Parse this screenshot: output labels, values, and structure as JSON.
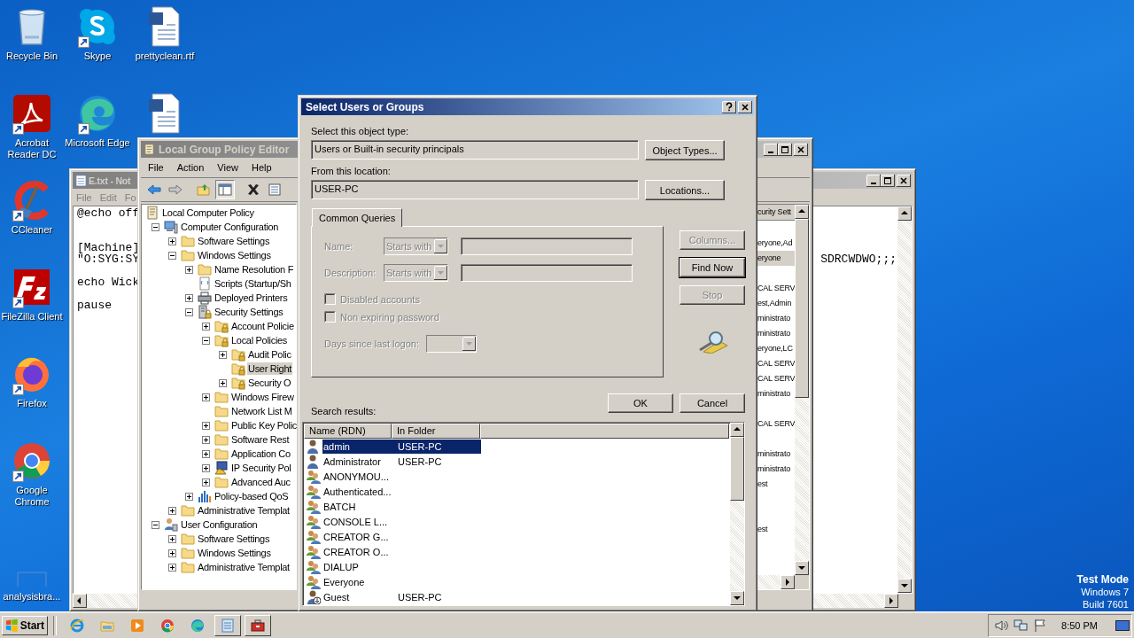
{
  "desktop": {
    "columns": [
      {
        "icons": [
          {
            "label": "Recycle Bin",
            "kind": "recycle",
            "shortcut": false
          },
          {
            "label": "Acrobat Reader DC",
            "kind": "acrobat",
            "shortcut": true
          },
          {
            "label": "CCleaner",
            "kind": "ccleaner",
            "shortcut": true
          },
          {
            "label": "FileZilla Client",
            "kind": "filezilla",
            "shortcut": true
          },
          {
            "label": "Firefox",
            "kind": "firefox",
            "shortcut": true
          },
          {
            "label": "Google Chrome",
            "kind": "chrome",
            "shortcut": true
          },
          {
            "label": "analysisbra...",
            "kind": "blank",
            "shortcut": false
          }
        ]
      },
      {
        "icons": [
          {
            "label": "Skype",
            "kind": "skype",
            "shortcut": true
          },
          {
            "label": "Microsoft Edge",
            "kind": "edge",
            "shortcut": true
          }
        ]
      },
      {
        "icons": [
          {
            "label": "prettyclean.rtf",
            "kind": "word",
            "shortcut": false
          },
          {
            "kind": "word",
            "shortcut": false
          }
        ]
      }
    ]
  },
  "system_text": [
    "Test Mode",
    "Windows 7",
    "Build 7601"
  ],
  "notepad": {
    "title": "E.txt - Not",
    "menu": [
      "File",
      "Edit",
      "Fo"
    ],
    "lines": [
      {
        "kind": "text",
        "left": "@echo off"
      },
      {
        "kind": "blank"
      },
      {
        "kind": "blank"
      },
      {
        "kind": "text",
        "left": "[Machine]"
      },
      {
        "kind": "text",
        "left": "\"O:SYG:SY",
        "right": "SDRCWDWO;;;"
      },
      {
        "kind": "blank"
      },
      {
        "kind": "text",
        "left": "echo Wick"
      },
      {
        "kind": "blank"
      },
      {
        "kind": "text",
        "left": "pause"
      }
    ]
  },
  "policy_editor": {
    "title": "Local Group Policy Editor",
    "menu": [
      "File",
      "Action",
      "View",
      "Help"
    ],
    "toolbar": [
      {
        "kind": "back",
        "pressed": false
      },
      {
        "kind": "forward",
        "pressed": false
      },
      {
        "kind": "up",
        "pressed": false
      },
      {
        "kind": "console",
        "pressed": true
      },
      {
        "kind": "delete",
        "pressed": false
      },
      {
        "kind": "properties",
        "pressed": false
      }
    ],
    "tree": [
      {
        "label": "Local Computer Policy",
        "kind": "scroll",
        "selected": false,
        "children": [
          {
            "label": "Computer Configuration",
            "kind": "computer",
            "expanded": true,
            "selected": false,
            "children": [
              {
                "label": "Software Settings",
                "kind": "folder",
                "expanded": false,
                "selected": false
              },
              {
                "label": "Windows Settings",
                "kind": "folder",
                "expanded": true,
                "selected": false,
                "children": [
                  {
                    "label": "Name Resolution F",
                    "kind": "folder",
                    "expanded": false,
                    "selected": false
                  },
                  {
                    "label": "Scripts (Startup/Sh",
                    "kind": "script",
                    "selected": false
                  },
                  {
                    "label": "Deployed Printers",
                    "kind": "printer",
                    "expanded": false,
                    "selected": false
                  },
                  {
                    "label": "Security Settings",
                    "kind": "server",
                    "expanded": true,
                    "selected": false,
                    "children": [
                      {
                        "label": "Account Policie",
                        "kind": "lock-folder",
                        "expanded": false,
                        "selected": false
                      },
                      {
                        "label": "Local Policies",
                        "kind": "lock-folder",
                        "expanded": true,
                        "selected": false,
                        "children": [
                          {
                            "label": "Audit Polic",
                            "kind": "lock-folder",
                            "expanded": false,
                            "selected": false
                          },
                          {
                            "label": "User Right",
                            "kind": "lock-folder",
                            "selected": true
                          },
                          {
                            "label": "Security O",
                            "kind": "lock-folder",
                            "expanded": false,
                            "selected": false
                          }
                        ]
                      },
                      {
                        "label": "Windows Firew",
                        "kind": "folder",
                        "expanded": false,
                        "selected": false
                      },
                      {
                        "label": "Network List M",
                        "kind": "folder",
                        "selected": false
                      },
                      {
                        "label": "Public Key Polic",
                        "kind": "folder",
                        "expanded": false,
                        "selected": false
                      },
                      {
                        "label": "Software Rest",
                        "kind": "folder",
                        "expanded": false,
                        "selected": false
                      },
                      {
                        "label": "Application Co",
                        "kind": "folder",
                        "expanded": false,
                        "selected": false
                      },
                      {
                        "label": "IP Security Pol",
                        "kind": "monitor",
                        "expanded": false,
                        "selected": false
                      },
                      {
                        "label": "Advanced Auc",
                        "kind": "folder",
                        "expanded": false,
                        "selected": false
                      }
                    ]
                  },
                  {
                    "label": "Policy-based QoS",
                    "kind": "chart",
                    "expanded": false,
                    "selected": false
                  }
                ]
              },
              {
                "label": "Administrative Templat",
                "kind": "folder",
                "expanded": false,
                "selected": false
              }
            ]
          },
          {
            "label": "User Configuration",
            "kind": "users",
            "expanded": true,
            "selected": false,
            "children": [
              {
                "label": "Software Settings",
                "kind": "folder",
                "expanded": false,
                "selected": false
              },
              {
                "label": "Windows Settings",
                "kind": "folder",
                "expanded": false,
                "selected": false
              },
              {
                "label": "Administrative Templat",
                "kind": "folder",
                "expanded": false,
                "selected": false
              }
            ]
          }
        ]
      }
    ],
    "list_header": "curity Sett",
    "list_rows": [
      {
        "kind": "blank"
      },
      {
        "kind": "text",
        "text": "eryone,Ad",
        "selected": false
      },
      {
        "kind": "text",
        "text": "eryone",
        "selected": true
      },
      {
        "kind": "blank"
      },
      {
        "kind": "text",
        "text": "CAL SERV",
        "selected": false
      },
      {
        "kind": "text",
        "text": "est,Admin",
        "selected": false
      },
      {
        "kind": "text",
        "text": "ministrato",
        "selected": false
      },
      {
        "kind": "text",
        "text": "ministrato",
        "selected": false
      },
      {
        "kind": "text",
        "text": "eryone,LC",
        "selected": false
      },
      {
        "kind": "text",
        "text": "CAL SERV",
        "selected": false
      },
      {
        "kind": "text",
        "text": "CAL SERV",
        "selected": false
      },
      {
        "kind": "text",
        "text": "ministrato",
        "selected": false
      },
      {
        "kind": "blank"
      },
      {
        "kind": "text",
        "text": "CAL SERV",
        "selected": false
      },
      {
        "kind": "blank"
      },
      {
        "kind": "text",
        "text": "ministrato",
        "selected": false
      },
      {
        "kind": "text",
        "text": "ministrato",
        "selected": false
      },
      {
        "kind": "text",
        "text": "est",
        "selected": false
      },
      {
        "kind": "blank"
      },
      {
        "kind": "blank"
      },
      {
        "kind": "text",
        "text": "est",
        "selected": false
      }
    ]
  },
  "dialog": {
    "title": "Select Users or Groups",
    "object_type": {
      "label": "Select this object type:",
      "value": "Users or Built-in security principals",
      "button": "Object Types..."
    },
    "location": {
      "label": "From this location:",
      "value": "USER-PC",
      "button": "Locations..."
    },
    "tabs": [
      {
        "label": "Common Queries",
        "selected": true
      }
    ],
    "query": {
      "disabled": true,
      "name_label": "Name:",
      "name_mode": "Starts with",
      "description_label": "Description:",
      "description_mode": "Starts with",
      "checkboxes": [
        {
          "label": "Disabled accounts",
          "checked": false
        },
        {
          "label": "Non expiring password",
          "checked": false
        }
      ],
      "days_label": "Days since last logon:"
    },
    "side_buttons": [
      {
        "label": "Columns...",
        "disabled": true,
        "default": false
      },
      {
        "label": "Find Now",
        "disabled": false,
        "default": true
      },
      {
        "label": "Stop",
        "disabled": true,
        "default": false
      }
    ],
    "ok": "OK",
    "cancel": "Cancel",
    "results_label": "Search results:",
    "columns": [
      "Name (RDN)",
      "In Folder"
    ],
    "rows": [
      {
        "name": "admin",
        "folder": "USER-PC",
        "kind": "user",
        "selected": true
      },
      {
        "name": "Administrator",
        "folder": "USER-PC",
        "kind": "user",
        "selected": false
      },
      {
        "name": "ANONYMOU...",
        "kind": "group",
        "selected": false
      },
      {
        "name": "Authenticated...",
        "kind": "group",
        "selected": false
      },
      {
        "name": "BATCH",
        "kind": "group",
        "selected": false
      },
      {
        "name": "CONSOLE L...",
        "kind": "group",
        "selected": false
      },
      {
        "name": "CREATOR G...",
        "kind": "group",
        "selected": false
      },
      {
        "name": "CREATOR O...",
        "kind": "group",
        "selected": false
      },
      {
        "name": "DIALUP",
        "kind": "group",
        "selected": false
      },
      {
        "name": "Everyone",
        "kind": "group",
        "selected": false
      },
      {
        "name": "Guest",
        "folder": "USER-PC",
        "kind": "guest",
        "selected": false
      }
    ]
  },
  "taskbar": {
    "start": "Start",
    "items": [
      {
        "kind": "ie",
        "open": false
      },
      {
        "kind": "explorer",
        "open": false
      },
      {
        "kind": "media",
        "open": false
      },
      {
        "kind": "chrome",
        "open": false
      },
      {
        "kind": "edge",
        "open": false
      },
      {
        "kind": "notepad",
        "open": true
      },
      {
        "kind": "toolbox",
        "open": true
      }
    ],
    "clock": "8:50 PM"
  }
}
